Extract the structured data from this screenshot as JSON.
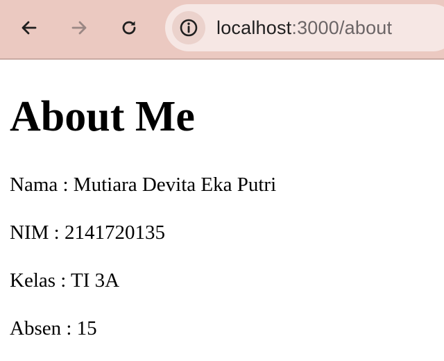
{
  "browser": {
    "url_host": "localhost",
    "url_rest": ":3000/about",
    "icons": {
      "back": "arrow-left-icon",
      "forward": "arrow-right-icon",
      "reload": "reload-icon",
      "site_info": "info-icon"
    },
    "colors": {
      "toolbar": "#ebc9c1",
      "omnibox": "#f6e7e4"
    }
  },
  "page": {
    "title": "About Me",
    "lines": [
      "Nama : Mutiara Devita Eka Putri",
      "NIM : 2141720135",
      "Kelas : TI 3A",
      "Absen : 15"
    ]
  }
}
